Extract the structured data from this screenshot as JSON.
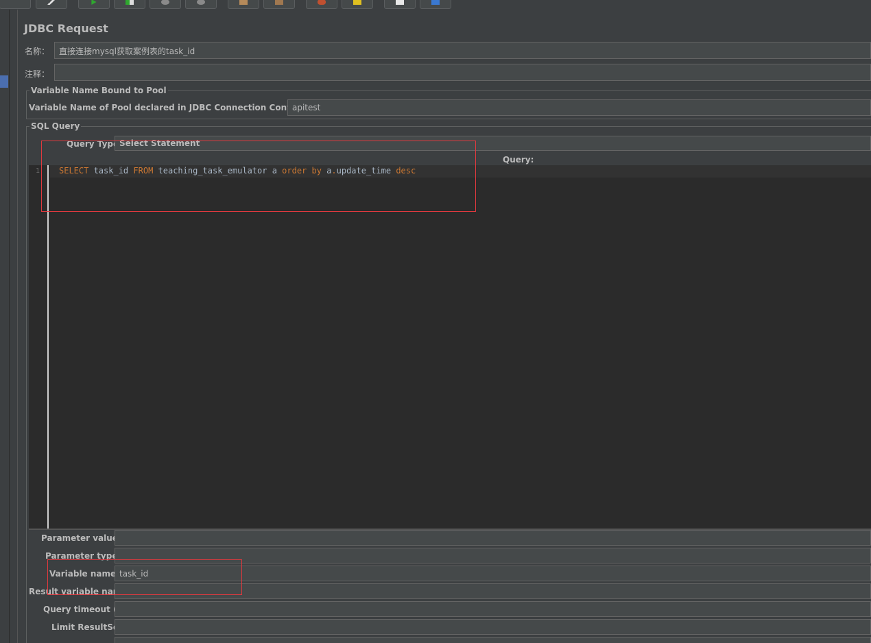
{
  "panel": {
    "title": "JDBC Request",
    "name_label": "名称：",
    "name_value": "直接连接mysql获取案例表的task_id",
    "comment_label": "注释：",
    "comment_value": ""
  },
  "pool_group": {
    "title": "Variable Name Bound to Pool",
    "label": "Variable Name of Pool declared in JDBC Connection Configuration:",
    "value": "apitest"
  },
  "sql_group": {
    "title": "SQL Query",
    "query_type_label": "Query Type:",
    "query_type_value": "Select Statement",
    "query_header": "Query:",
    "line_number": "1",
    "code_tokens": {
      "t1": "SELECT",
      "t2": " task_id ",
      "t3": "FROM",
      "t4": " teaching_task_emulator a ",
      "t5": "order by",
      "t6": " a",
      "t7": ".",
      "t8": "update_time ",
      "t9": "desc"
    }
  },
  "params": {
    "parameter_values_label": "Parameter values:",
    "parameter_values_value": "",
    "parameter_types_label": "Parameter types:",
    "parameter_types_value": "",
    "variable_names_label": "Variable names:",
    "variable_names_value": "task_id",
    "result_variable_label": "Result variable name:",
    "result_variable_value": "",
    "query_timeout_label": "Query timeout (s):",
    "query_timeout_value": "",
    "limit_resultset_label": "Limit ResultSet:",
    "limit_resultset_value": ""
  },
  "colors": {
    "background": "#3c3f41",
    "editor": "#2b2b2b",
    "keyword": "#cc7832",
    "highlight": "#e0393e"
  }
}
